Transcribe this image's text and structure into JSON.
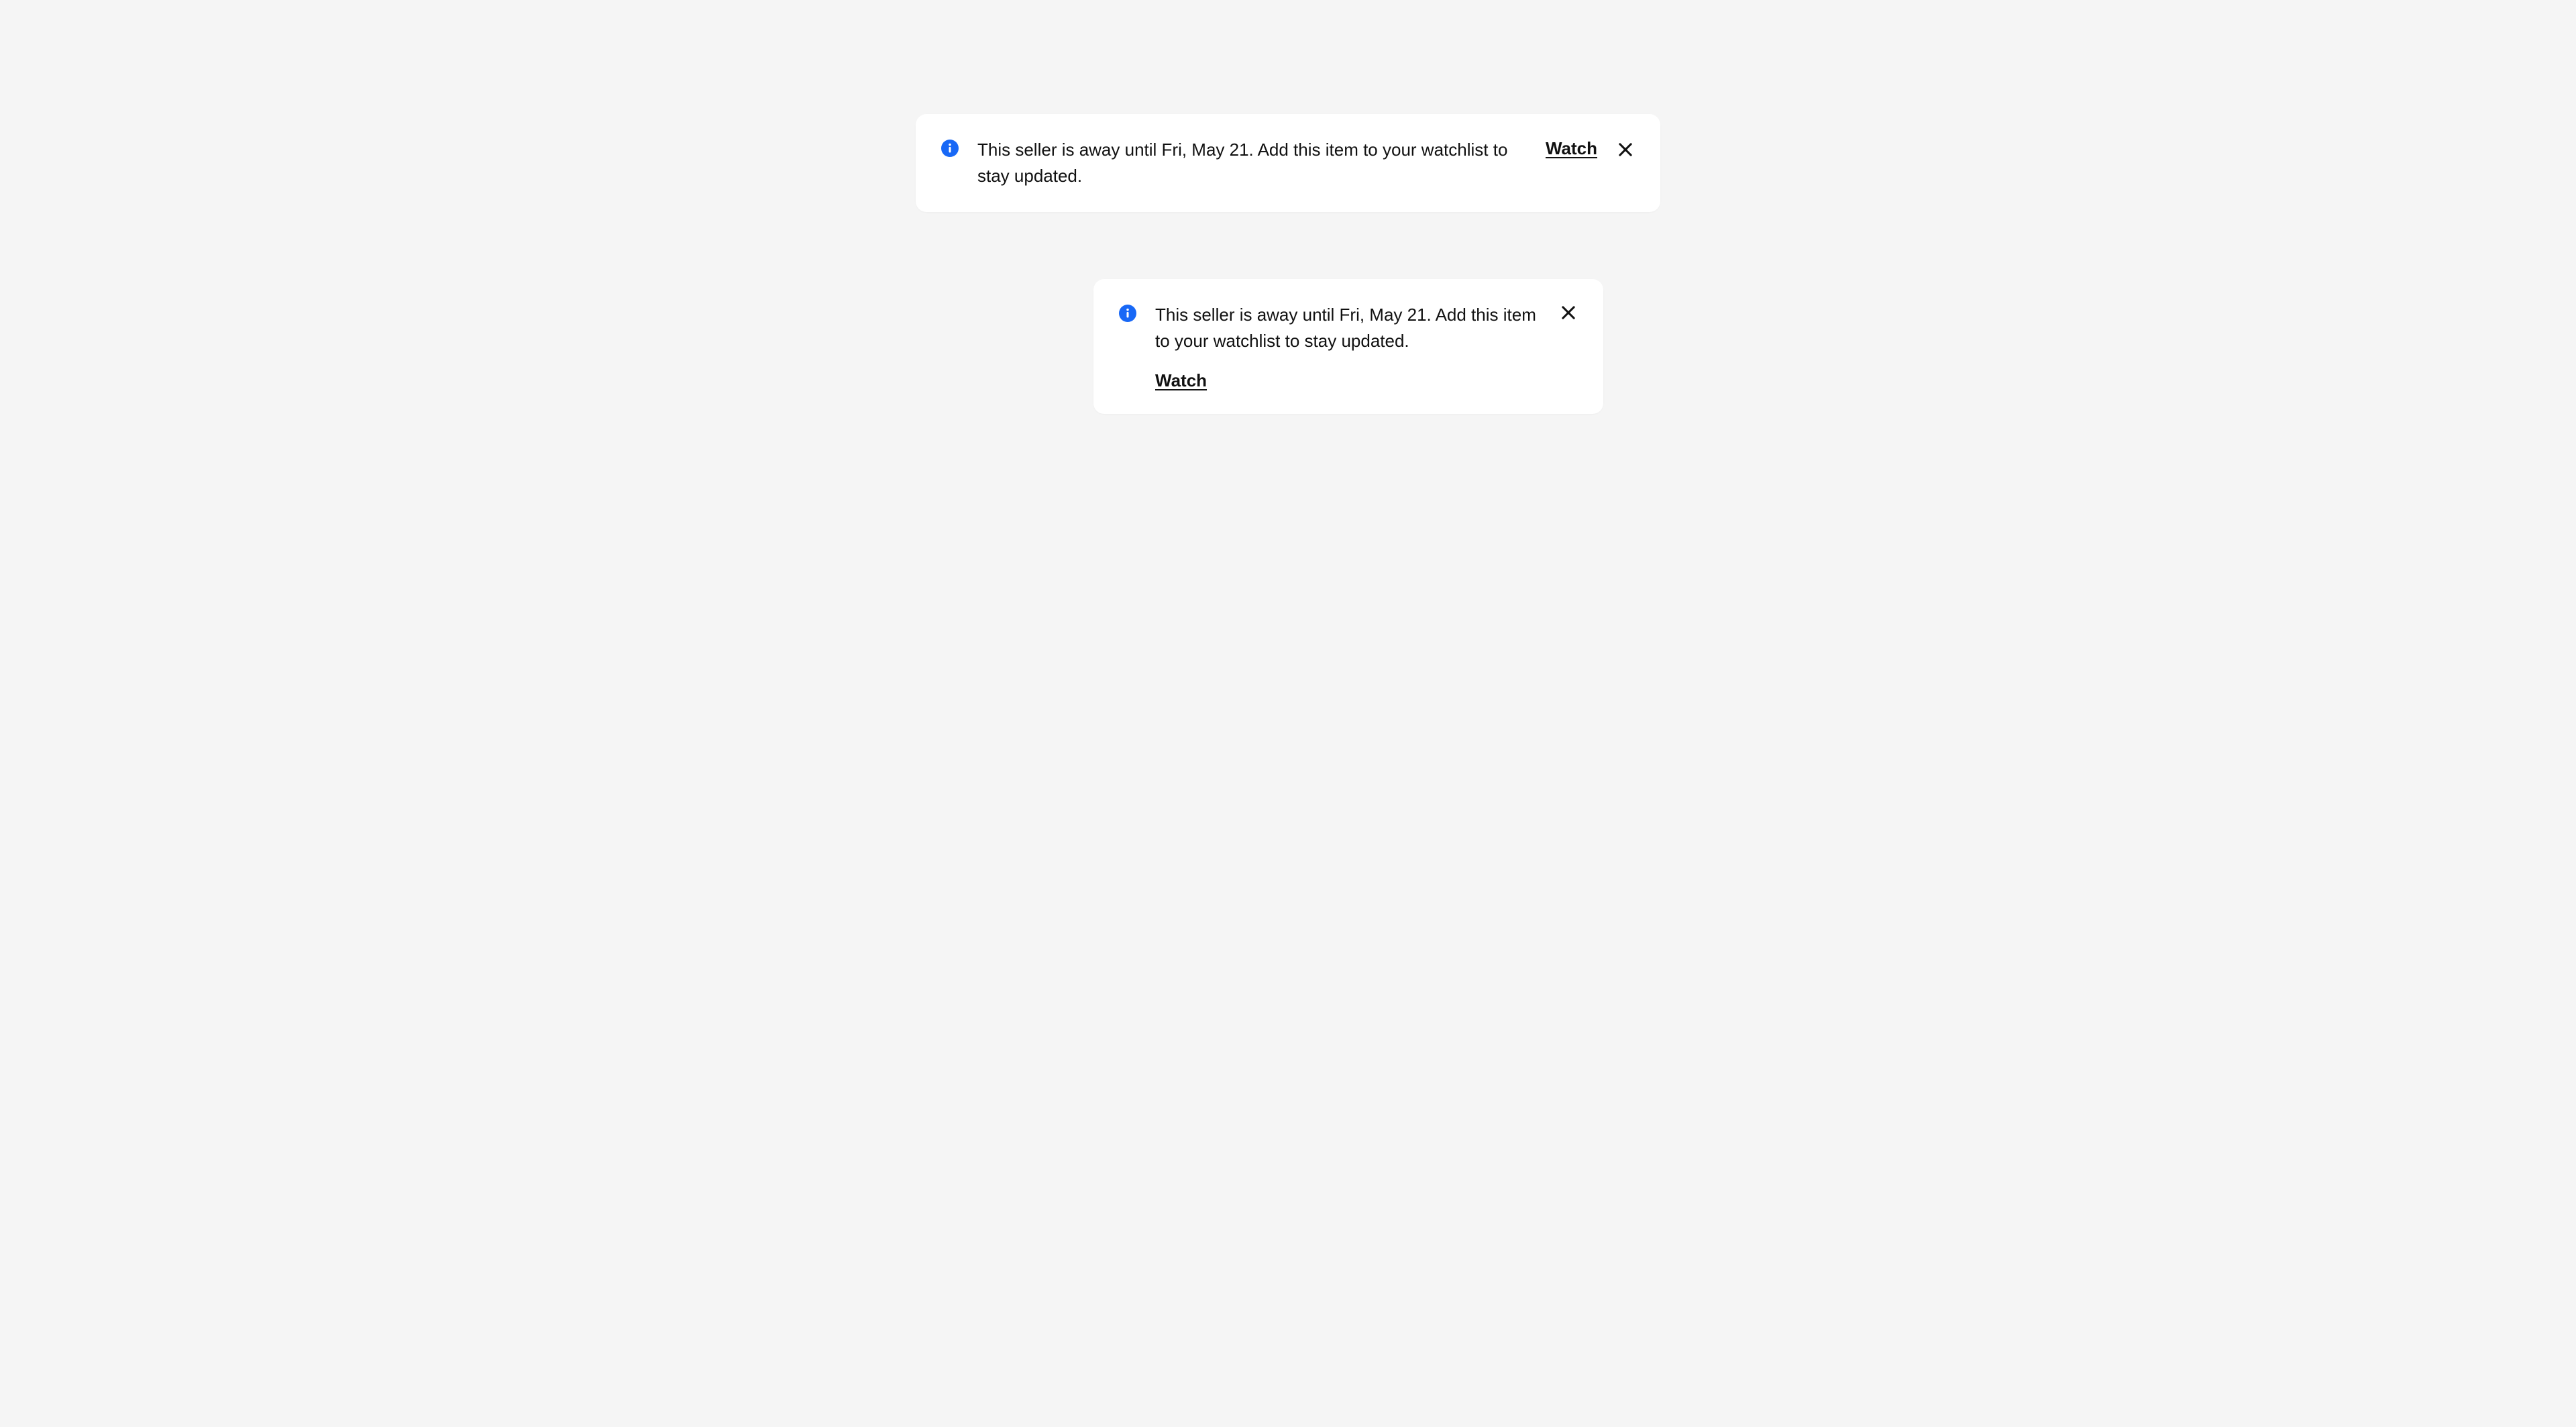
{
  "notices": {
    "wide": {
      "message": "This seller is away until Fri, May 21. Add this item to your watchlist to stay updated.",
      "action_label": "Watch"
    },
    "narrow": {
      "message": "This seller is away until Fri, May 21. Add this item to your watchlist to stay updated.",
      "action_label": "Watch"
    }
  },
  "icons": {
    "info": "info-icon",
    "close": "close-icon"
  },
  "colors": {
    "info_bg": "#1868f6",
    "text": "#111111",
    "card_bg": "#ffffff",
    "page_bg": "#f5f5f5"
  }
}
